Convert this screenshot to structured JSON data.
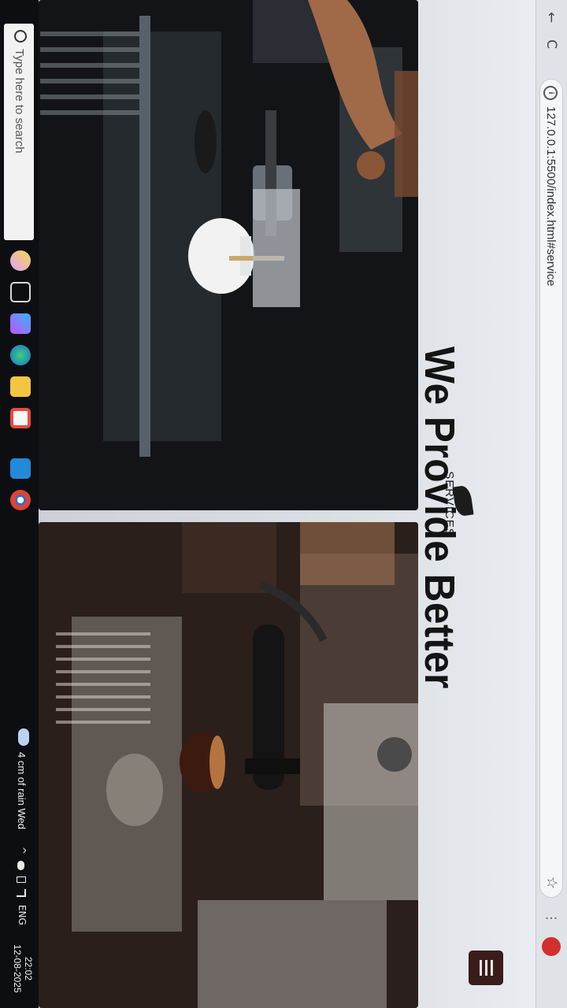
{
  "browser": {
    "url": "127.0.0.1:5500/index.html#service",
    "back_glyph": "←",
    "reload_glyph": "C",
    "site_info_glyph": "i",
    "bookmark_glyph": "☆",
    "extensions_glyph": "⋮",
    "icons": [
      "back-arrow-icon",
      "reload-icon",
      "site-info-icon",
      "bookmark-star-icon",
      "profile-avatar"
    ]
  },
  "page": {
    "section_tag": "SERVICES",
    "hero_title": "We Provide Better",
    "menu_icon": "hamburger-menu-icon",
    "accent_color": "#3a1d1a",
    "photos": [
      "espresso-tap-photo",
      "espresso-machine-shots-photo"
    ]
  },
  "taskbar": {
    "search_placeholder": "Type here to search",
    "pinned_icons": [
      "copilot-icon",
      "task-view-icon",
      "copilot-app-icon",
      "edge-icon",
      "file-explorer-icon",
      "store-icon",
      "vscode-icon",
      "chrome-icon"
    ],
    "weather": "4 cm of rain Wed",
    "tray_chevron": "^",
    "language": "ENG",
    "time": "22:02",
    "date": "12-08-2025"
  }
}
